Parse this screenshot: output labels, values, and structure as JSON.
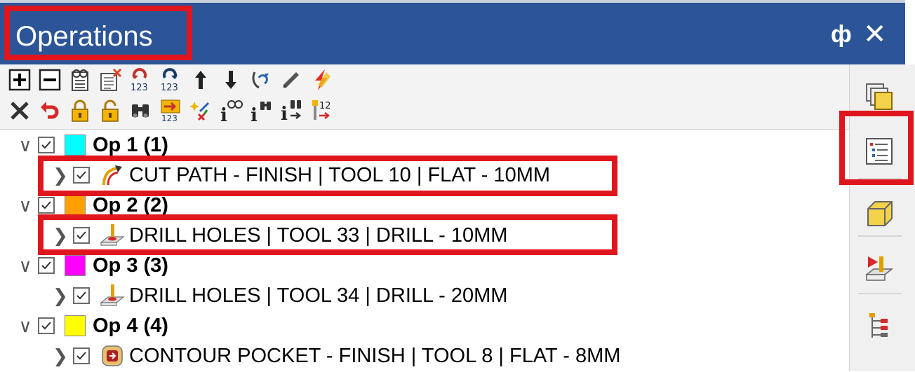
{
  "panel": {
    "title": "Operations",
    "pin_glyph": "ф",
    "close_glyph": "✕",
    "pin_icon": "pin-icon",
    "close_icon": "close-icon"
  },
  "toolbar": {
    "row1": [
      "add-icon",
      "remove-icon",
      "edit-properties-icon",
      "delete-sheet-icon",
      "renumber-123-icon",
      "renumber-reverse-123-icon",
      "move-up-icon",
      "move-down-icon",
      "regenerate-icon",
      "pencil-icon",
      "lightning-icon"
    ],
    "row2": [
      "delete-x-icon",
      "undo-icon",
      "lock-icon",
      "unlock-icon",
      "binoculars-icon",
      "renumber-tool-icon",
      "sparkle-icon",
      "info-glasses-icon",
      "info-binoculars-icon",
      "info-binoculars-arrow-icon",
      "tool-number-12-icon"
    ]
  },
  "sidebar": [
    "layers-icon",
    "operations-list-icon",
    "stock-box-icon",
    "toolpath-sim-icon",
    "tree-hierarchy-icon"
  ],
  "groups": [
    {
      "label": "Op 1 (1)",
      "color": "#00ffff",
      "checked": true,
      "ops": [
        {
          "label": "CUT PATH - FINISH | TOOL 10 | FLAT - 10MM",
          "icon": "cut-path-icon",
          "checked": true
        }
      ]
    },
    {
      "label": "Op 2 (2)",
      "color": "#ffa000",
      "checked": true,
      "ops": [
        {
          "label": "DRILL HOLES | TOOL 33 | DRILL - 10MM",
          "icon": "drill-holes-icon",
          "checked": true
        }
      ]
    },
    {
      "label": "Op 3 (3)",
      "color": "#ff00ff",
      "checked": true,
      "ops": [
        {
          "label": "DRILL HOLES | TOOL 34 | DRILL - 20MM",
          "icon": "drill-holes-icon",
          "checked": true
        }
      ]
    },
    {
      "label": "Op 4 (4)",
      "color": "#ffff00",
      "checked": true,
      "ops": [
        {
          "label": "CONTOUR POCKET - FINISH | TOOL 8 | FLAT - 8MM",
          "icon": "contour-pocket-icon",
          "checked": true
        }
      ]
    }
  ],
  "expand_glyph": "∨",
  "collapse_glyph": "❯",
  "highlight_color": "#e0161e"
}
